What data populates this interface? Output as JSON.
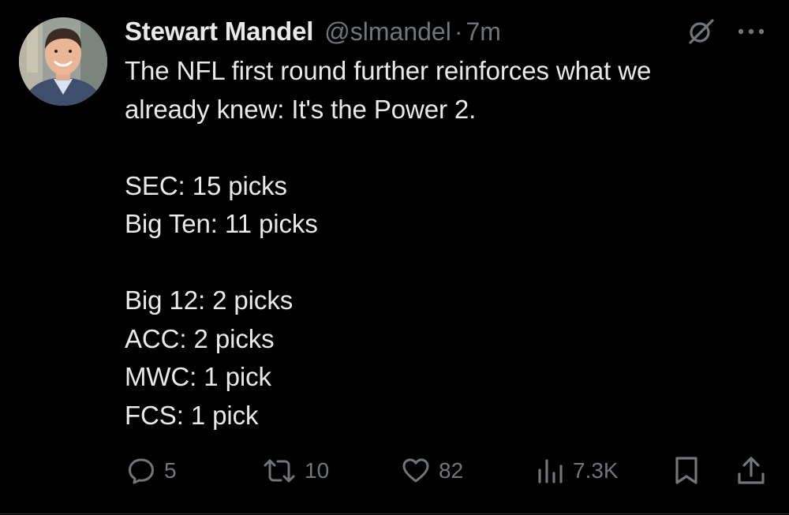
{
  "author": {
    "display_name": "Stewart Mandel",
    "handle": "@slmandel",
    "separator": "·",
    "time": "7m"
  },
  "tweet": {
    "lines": [
      "The NFL first round further reinforces what we",
      "already knew: It's the Power 2.",
      "",
      "SEC: 15 picks",
      "Big Ten: 11 picks",
      "",
      "Big 12: 2 picks",
      "ACC: 2 picks",
      "MWC: 1 pick",
      "FCS: 1 pick"
    ]
  },
  "actions": {
    "replies": "5",
    "reposts": "10",
    "likes": "82",
    "views": "7.3K"
  },
  "icons": {
    "grok": "grok-icon",
    "more": "more-icon",
    "reply": "reply-icon",
    "repost": "repost-icon",
    "like": "heart-icon",
    "views": "views-icon",
    "bookmark": "bookmark-icon",
    "share": "share-icon"
  },
  "colors": {
    "background": "#000000",
    "primary_text": "#e7e9ea",
    "secondary_text": "#71767b"
  }
}
